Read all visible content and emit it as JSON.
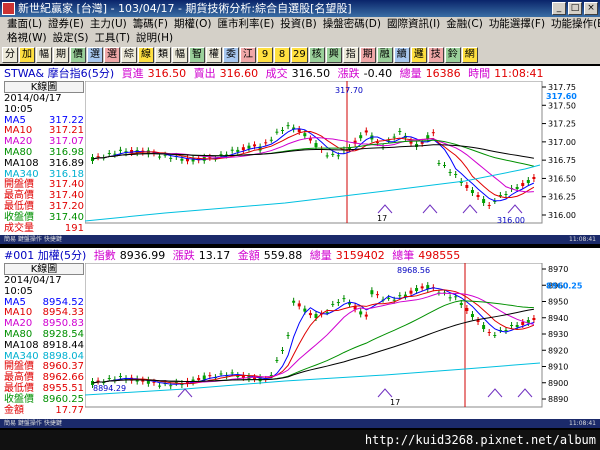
{
  "window": {
    "title": "新世紀贏家 [台灣] - 103/04/17 - 期貨技術分析:綜合自選股[名望股]"
  },
  "menu": {
    "row1": [
      "畫面(L)",
      "證券(E)",
      "主力(U)",
      "籌碼(F)",
      "期權(O)",
      "匯市利率(E)",
      "投資(B)",
      "操盤密碼(D)",
      "國際資訊(I)",
      "金融(C)",
      "功能選擇(F)",
      "功能操作(E)"
    ],
    "row2": [
      "格視(W)",
      "設定(S)",
      "工具(T)",
      "說明(H)"
    ]
  },
  "toolbar": {
    "buttons": [
      "分",
      "加",
      "幅",
      "期",
      "價",
      "選",
      "選",
      "綜",
      "線",
      "類",
      "幅",
      "智",
      "權",
      "委",
      "江",
      "9",
      "8",
      "29",
      "核",
      "興",
      "指",
      "期",
      "融",
      "續",
      "邏",
      "技",
      "鈴",
      "網"
    ]
  },
  "pane1": {
    "info": {
      "symbol": "STWA& 摩台指6(5分)",
      "bid_label": "買進",
      "bid": "316.50",
      "ask_label": "賣出",
      "ask": "316.60",
      "last_label": "成交",
      "last": "316.50",
      "change_label": "漲跌",
      "change": "-0.40",
      "volume_label": "總量",
      "volume": "16386",
      "time_label": "時間",
      "time": "11:08:41"
    },
    "legend": {
      "title": "K線圖",
      "date": "2014/04/17 10:05",
      "rows": [
        {
          "label": "MA5",
          "value": "317.22",
          "color": "#0000ff"
        },
        {
          "label": "MA10",
          "value": "317.21",
          "color": "#e00000"
        },
        {
          "label": "MA20",
          "value": "317.07",
          "color": "#d000d0"
        },
        {
          "label": "MA80",
          "value": "316.98",
          "color": "#009000"
        },
        {
          "label": "MA108",
          "value": "316.89",
          "color": "#000000"
        },
        {
          "label": "MA340",
          "value": "316.18",
          "color": "#00b0d0"
        },
        {
          "label": "開盤價",
          "value": "317.40",
          "color": "#e00000"
        },
        {
          "label": "最高價",
          "value": "317.40",
          "color": "#e00000"
        },
        {
          "label": "最低價",
          "value": "317.20",
          "color": "#e00000"
        },
        {
          "label": "收盤價",
          "value": "317.40",
          "color": "#009000"
        },
        {
          "label": "成交量",
          "value": "191",
          "color": "#e00000"
        }
      ]
    },
    "axis": {
      "ticks": [
        "317.75",
        "317.50",
        "317.25",
        "317.00",
        "316.75",
        "316.50",
        "316.25",
        "316.00"
      ],
      "current": "317.60",
      "high_mark": "317.70",
      "low_mark": "316.00",
      "x_label": "17"
    },
    "footer_left": "簡易 鍵盤操作 快捷鍵",
    "footer_right": "11:08:41"
  },
  "pane2": {
    "info": {
      "symbol": "#001 加權(5分)",
      "index_label": "指數",
      "index": "8936.99",
      "change_label": "漲跌",
      "change": "13.17",
      "amount_label": "金額",
      "amount": "559.88",
      "vol_label": "總量",
      "vol": "3159402",
      "count_label": "總筆",
      "count": "498555"
    },
    "legend": {
      "title": "K線圖",
      "date": "2014/04/17 10:05",
      "rows": [
        {
          "label": "MA5",
          "value": "8954.52",
          "color": "#0000ff"
        },
        {
          "label": "MA10",
          "value": "8954.33",
          "color": "#e00000"
        },
        {
          "label": "MA20",
          "value": "8950.83",
          "color": "#d000d0"
        },
        {
          "label": "MA80",
          "value": "8928.54",
          "color": "#009000"
        },
        {
          "label": "MA108",
          "value": "8918.44",
          "color": "#000000"
        },
        {
          "label": "MA340",
          "value": "8898.04",
          "color": "#00b0d0"
        },
        {
          "label": "開盤價",
          "value": "8960.37",
          "color": "#e00000"
        },
        {
          "label": "最高價",
          "value": "8962.66",
          "color": "#e00000"
        },
        {
          "label": "最低價",
          "value": "8955.51",
          "color": "#e00000"
        },
        {
          "label": "收盤價",
          "value": "8960.25",
          "color": "#009000"
        },
        {
          "label": "金額",
          "value": "17.77",
          "color": "#e00000"
        }
      ]
    },
    "axis": {
      "ticks": [
        "8970",
        "8960",
        "8950",
        "8940",
        "8930",
        "8920",
        "8910",
        "8900",
        "8890"
      ],
      "current": "8960.25",
      "high_mark": "8968.56",
      "low_mark": "8894.29",
      "x_label": "17"
    },
    "footer_left": "簡易 鍵盤操作 快捷鍵",
    "footer_right": "11:08:41"
  },
  "status": {
    "url": "http://kuid3268.pixnet.net/album"
  }
}
